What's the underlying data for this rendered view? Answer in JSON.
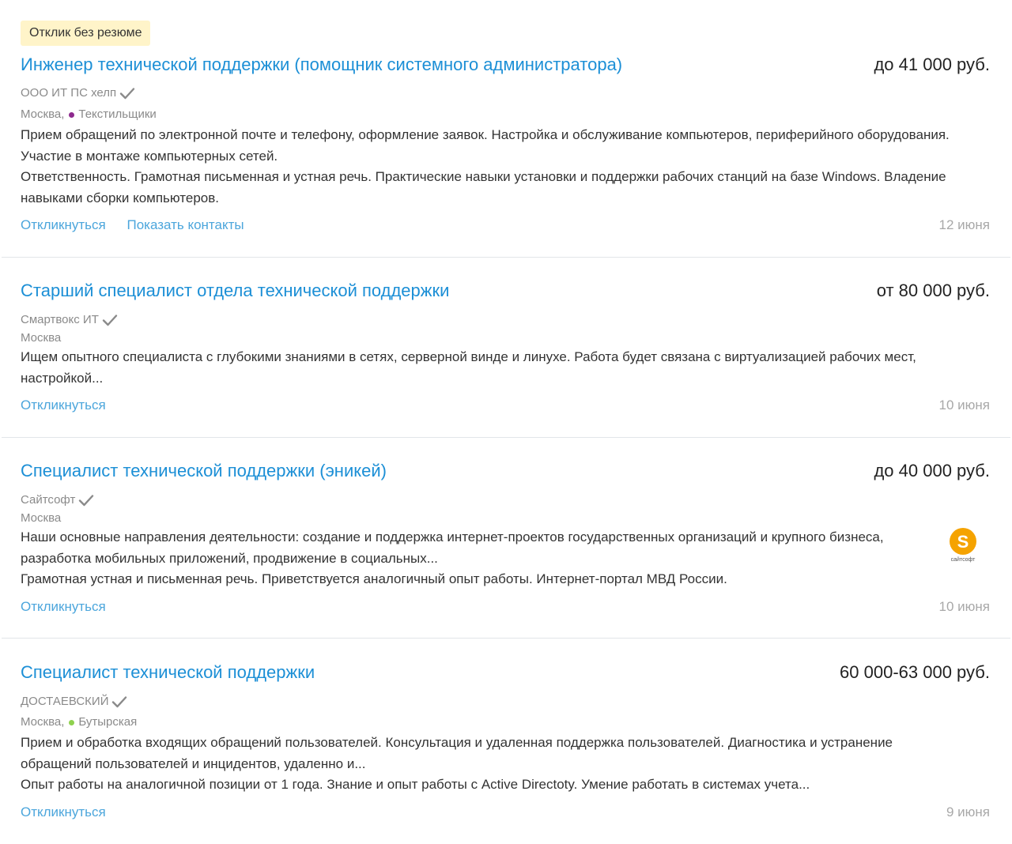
{
  "colors": {
    "link": "#1c8fd6",
    "action_link": "#4ca6dc",
    "badge_bg": "#fff4c9",
    "metro_textilshchiki": "#8e2a8e",
    "metro_butyrskaya": "#8fd14f",
    "logo_saitsoft": "#f5a300"
  },
  "vacancies": [
    {
      "badge": "Отклик без резюме",
      "title": "Инженер технической поддержки (помощник системного администратора)",
      "salary": "до 41 000 руб.",
      "employer": "ООО ИТ ПС хелп",
      "employer_icon": "check-icon",
      "city": "Москва,",
      "metro": "Текстильщики",
      "description": [
        "Прием обращений по электронной почте и телефону, оформление заявок. Настройка и обслуживание компьютеров, периферийного оборудования. Участие в монтаже компьютерных сетей.",
        "Ответственность. Грамотная письменная и устная речь. Практические навыки установки и поддержки рабочих станций на базе Windows. Владение навыками сборки компьютеров."
      ],
      "actions": [
        "Откликнуться",
        "Показать контакты"
      ],
      "date": "12 июня"
    },
    {
      "title": "Старший специалист отдела технической поддержки",
      "salary": "от 80 000 руб.",
      "employer": "Смартвокс ИТ",
      "employer_icon": "check-icon",
      "city": "Москва",
      "description": [
        "Ищем опытного специалиста с глубокими знаниями в сетях, серверной винде и линухе. Работа будет связана с виртуализацией рабочих мест, настройкой..."
      ],
      "actions": [
        "Откликнуться"
      ],
      "date": "10 июня"
    },
    {
      "title": "Специалист технической поддержки (эникей)",
      "salary": "до 40 000 руб.",
      "employer": "Сайтсофт",
      "employer_icon": "check-icon",
      "city": "Москва",
      "description": [
        "Наши основные направления деятельности: создание и поддержка интернет-проектов государственных организаций и крупного бизнеса, разработка мобильных приложений, продвижение в социальных...",
        "Грамотная устная и письменная речь. Приветствуется аналогичный опыт работы. Интернет-портал МВД России."
      ],
      "logo": {
        "letter": "S",
        "caption": "сайтсофт"
      },
      "actions": [
        "Откликнуться"
      ],
      "date": "10 июня"
    },
    {
      "title": "Специалист технической поддержки",
      "salary": "60 000-63 000 руб.",
      "employer": "ДОСТАЕВСКИЙ",
      "employer_icon": "check-icon",
      "city": "Москва,",
      "metro": "Бутырская",
      "description": [
        "Прием и обработка входящих обращений пользователей. Консультация и удаленная поддержка пользователей. Диагностика и устранение обращений пользователей и инцидентов, удаленно и...",
        "Опыт работы на аналогичной позиции от 1 года. Знание и опыт работы с Active Directoty. Умение работать в системах учета..."
      ],
      "actions": [
        "Откликнуться"
      ],
      "date": "9 июня"
    }
  ]
}
